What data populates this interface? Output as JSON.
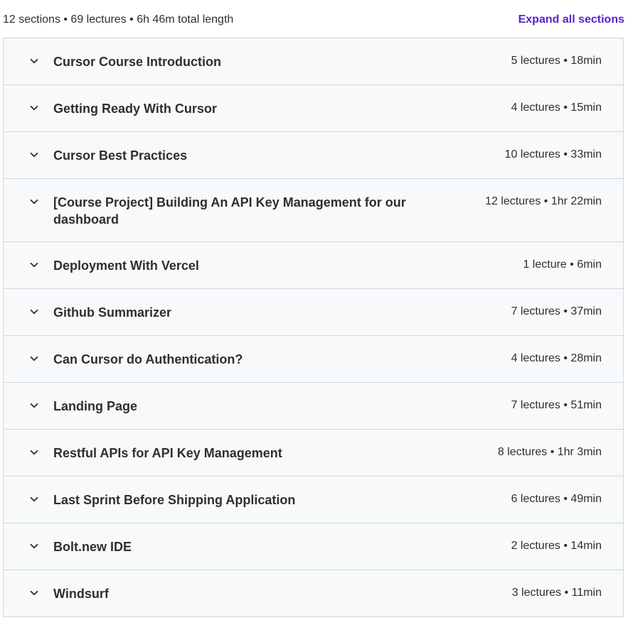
{
  "header": {
    "summary": "12 sections • 69 lectures • 6h 46m total length",
    "expand_label": "Expand all sections"
  },
  "icons": {
    "section_toggle": "chevron-down-icon"
  },
  "colors": {
    "accent": "#5624d0",
    "section_bg": "#f7f9fa",
    "border": "#d1d7dc",
    "text": "#2d2f31"
  },
  "sections": [
    {
      "title": "Cursor Course Introduction",
      "meta": "5 lectures • 18min"
    },
    {
      "title": "Getting Ready With Cursor",
      "meta": "4 lectures • 15min"
    },
    {
      "title": "Cursor Best Practices",
      "meta": "10 lectures • 33min"
    },
    {
      "title": "[Course Project] Building An API Key Management for our dashboard",
      "meta": "12 lectures • 1hr 22min"
    },
    {
      "title": "Deployment With Vercel",
      "meta": "1 lecture • 6min"
    },
    {
      "title": "Github Summarizer",
      "meta": "7 lectures • 37min"
    },
    {
      "title": "Can Cursor do Authentication?",
      "meta": "4 lectures • 28min"
    },
    {
      "title": "Landing Page",
      "meta": "7 lectures • 51min"
    },
    {
      "title": "Restful APIs for API Key Management",
      "meta": "8 lectures • 1hr 3min"
    },
    {
      "title": "Last Sprint Before Shipping Application",
      "meta": "6 lectures • 49min"
    },
    {
      "title": "Bolt.new IDE",
      "meta": "2 lectures • 14min"
    },
    {
      "title": "Windsurf",
      "meta": "3 lectures • 11min"
    }
  ]
}
